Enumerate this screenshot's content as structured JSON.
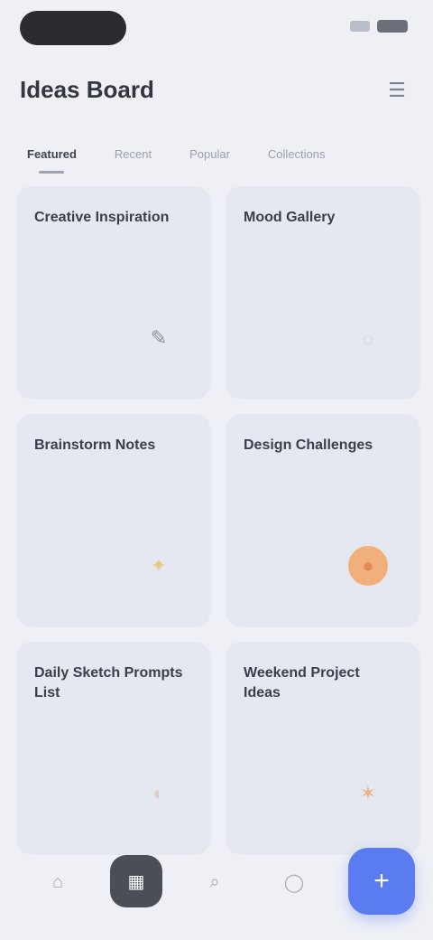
{
  "app": {
    "title": "Ideas Board"
  },
  "header": {
    "action_icon": "sliders-icon"
  },
  "tabs": [
    {
      "label": "Featured",
      "active": true
    },
    {
      "label": "Recent",
      "active": false
    },
    {
      "label": "Popular",
      "active": false
    },
    {
      "label": "Collections",
      "active": false
    }
  ],
  "cards": [
    {
      "title": "Creative Inspiration",
      "icon": "pencil-icon",
      "icon_glyph": "✎",
      "icon_color": "#8c909a",
      "icon_bg": "transparent"
    },
    {
      "title": "Mood Gallery",
      "icon": "sun-icon",
      "icon_glyph": "☼",
      "icon_color": "#d6d9e0",
      "icon_bg": "transparent"
    },
    {
      "title": "Brainstorm Notes",
      "icon": "lightbulb-icon",
      "icon_glyph": "✦",
      "icon_color": "#e7c98c",
      "icon_bg": "transparent"
    },
    {
      "title": "Design Challenges",
      "icon": "flame-icon",
      "icon_glyph": "●",
      "icon_color": "#e08a55",
      "icon_bg": "#f1b07b"
    },
    {
      "title": "Daily Sketch Prompts List",
      "icon": "palette-icon",
      "icon_glyph": "◐",
      "icon_color": "#d8d2c6",
      "icon_bg": "transparent"
    },
    {
      "title": "Weekend Project Ideas",
      "icon": "star-icon",
      "icon_glyph": "✶",
      "icon_color": "#e9b48c",
      "icon_bg": "transparent"
    }
  ],
  "nav": {
    "items": [
      {
        "name": "nav-home",
        "icon": "home-icon",
        "glyph": "⌂",
        "active": false
      },
      {
        "name": "nav-ideas",
        "icon": "grid-icon",
        "glyph": "▦",
        "active": true
      },
      {
        "name": "nav-search",
        "icon": "search-icon",
        "glyph": "⌕",
        "active": false
      },
      {
        "name": "nav-profile",
        "icon": "profile-icon",
        "glyph": "◯",
        "active": false
      }
    ],
    "fab": {
      "icon": "plus-icon",
      "glyph": "+",
      "color": "#5b7cf0"
    }
  }
}
